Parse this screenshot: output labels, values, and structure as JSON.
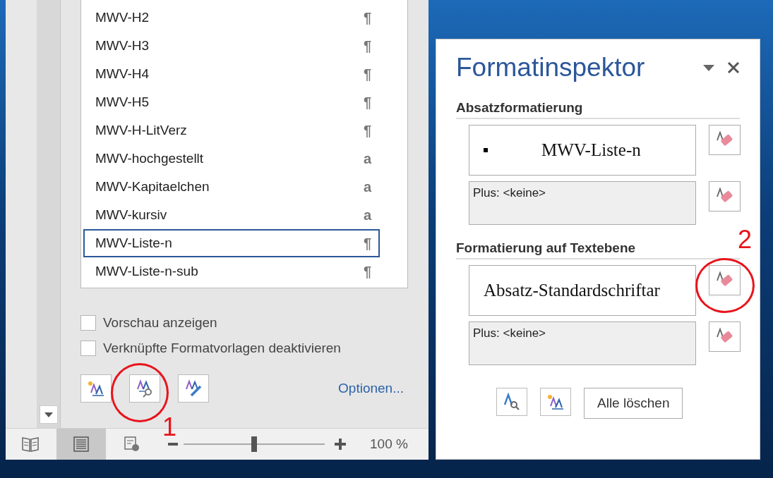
{
  "styles_list": {
    "items": [
      {
        "name": "MWV-H2",
        "symbol": "¶",
        "selected": false
      },
      {
        "name": "MWV-H3",
        "symbol": "¶",
        "selected": false
      },
      {
        "name": "MWV-H4",
        "symbol": "¶",
        "selected": false
      },
      {
        "name": "MWV-H5",
        "symbol": "¶",
        "selected": false
      },
      {
        "name": "MWV-H-LitVerz",
        "symbol": "¶",
        "selected": false
      },
      {
        "name": "MWV-hochgestellt",
        "symbol": "a",
        "selected": false
      },
      {
        "name": "MWV-Kapitaelchen",
        "symbol": "a",
        "selected": false
      },
      {
        "name": "MWV-kursiv",
        "symbol": "a",
        "selected": false
      },
      {
        "name": "MWV-Liste-n",
        "symbol": "¶",
        "selected": true
      },
      {
        "name": "MWV-Liste-n-sub",
        "symbol": "¶",
        "selected": false
      }
    ]
  },
  "options": {
    "checkboxes": [
      {
        "label": "Vorschau anzeigen",
        "checked": false
      },
      {
        "label": "Verknüpfte Formatvorlagen deaktivieren",
        "checked": false
      }
    ],
    "buttons": [
      {
        "kind": "new-style"
      },
      {
        "kind": "inspector"
      },
      {
        "kind": "manage"
      }
    ],
    "link": "Optionen..."
  },
  "status_bar": {
    "views": [
      {
        "kind": "read",
        "selected": false
      },
      {
        "kind": "print",
        "selected": true
      },
      {
        "kind": "web",
        "selected": false
      }
    ],
    "zoom": {
      "level": 0.5,
      "reading": "100 %"
    }
  },
  "inspector": {
    "title": "Formatinspektor",
    "sections": [
      {
        "heading": "Absatzformatierung",
        "style": {
          "text": "MWV-Liste-n",
          "bullet": true
        },
        "plus": "Plus: <keine>"
      },
      {
        "heading": "Formatierung auf Textebene",
        "style": {
          "text": "Absatz-Standardschriftar",
          "bullet": false
        },
        "plus": "Plus: <keine>"
      }
    ],
    "buttons": [
      {
        "kind": "reveal"
      },
      {
        "kind": "new-style"
      },
      {
        "kind": "text",
        "label": "Alle löschen"
      }
    ]
  },
  "annotations": [
    {
      "label": "1"
    },
    {
      "label": "2"
    }
  ]
}
